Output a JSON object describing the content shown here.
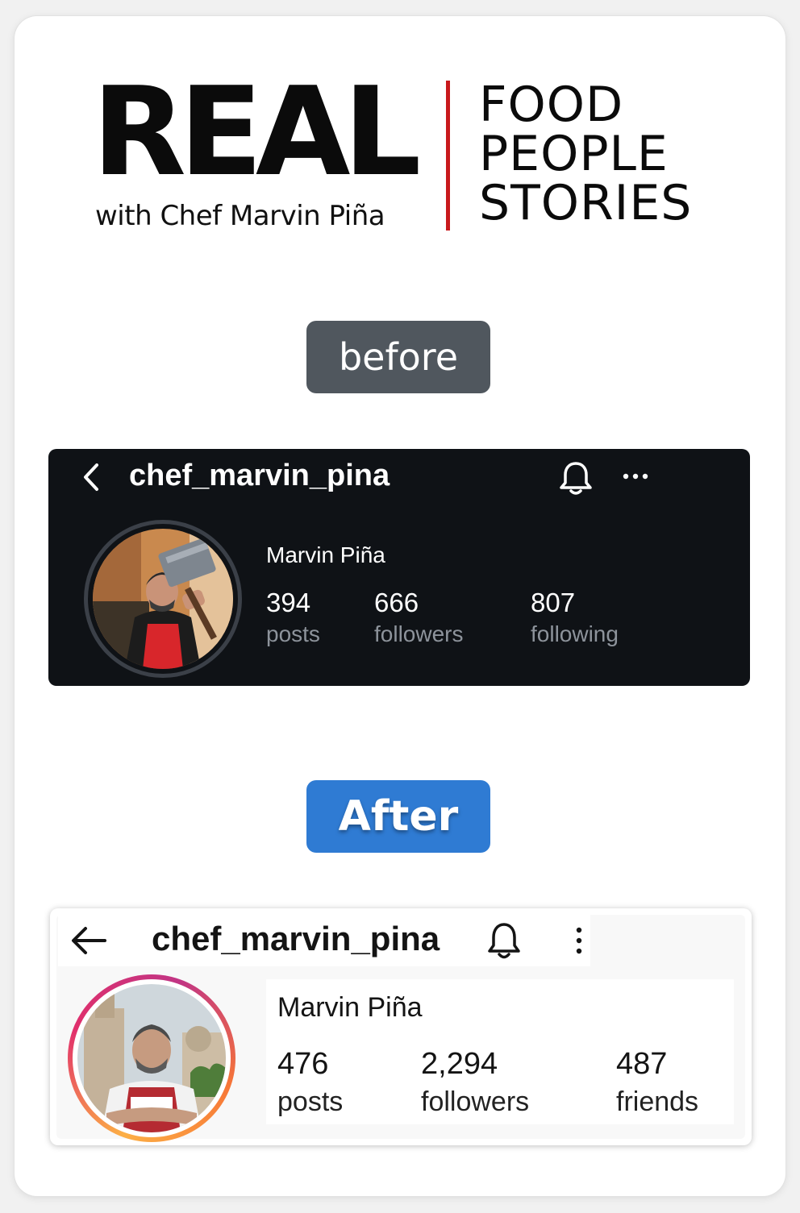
{
  "brand": {
    "real": "REAL",
    "subtitle": "with Chef Marvin Piña",
    "words": [
      "FOOD",
      "PEOPLE",
      "STORIES"
    ],
    "divider_color": "#c8191c"
  },
  "labels": {
    "before": "before",
    "after": "After"
  },
  "before": {
    "username": "chef_marvin_pina",
    "name": "Marvin Piña",
    "stats": [
      {
        "value": "394",
        "label": "posts"
      },
      {
        "value": "666",
        "label": "followers"
      },
      {
        "value": "807",
        "label": "following"
      }
    ],
    "icons": [
      "chevron-left-icon",
      "bell-icon",
      "more-horizontal-icon"
    ],
    "theme": "dark"
  },
  "after": {
    "username": "chef_marvin_pina",
    "name": "Marvin Piña",
    "stats": [
      {
        "value": "476",
        "label": "posts"
      },
      {
        "value": "2,294",
        "label": "followers"
      },
      {
        "value": "487",
        "label": "friends"
      }
    ],
    "icons": [
      "arrow-left-icon",
      "bell-icon",
      "more-vertical-icon"
    ],
    "theme": "light"
  }
}
